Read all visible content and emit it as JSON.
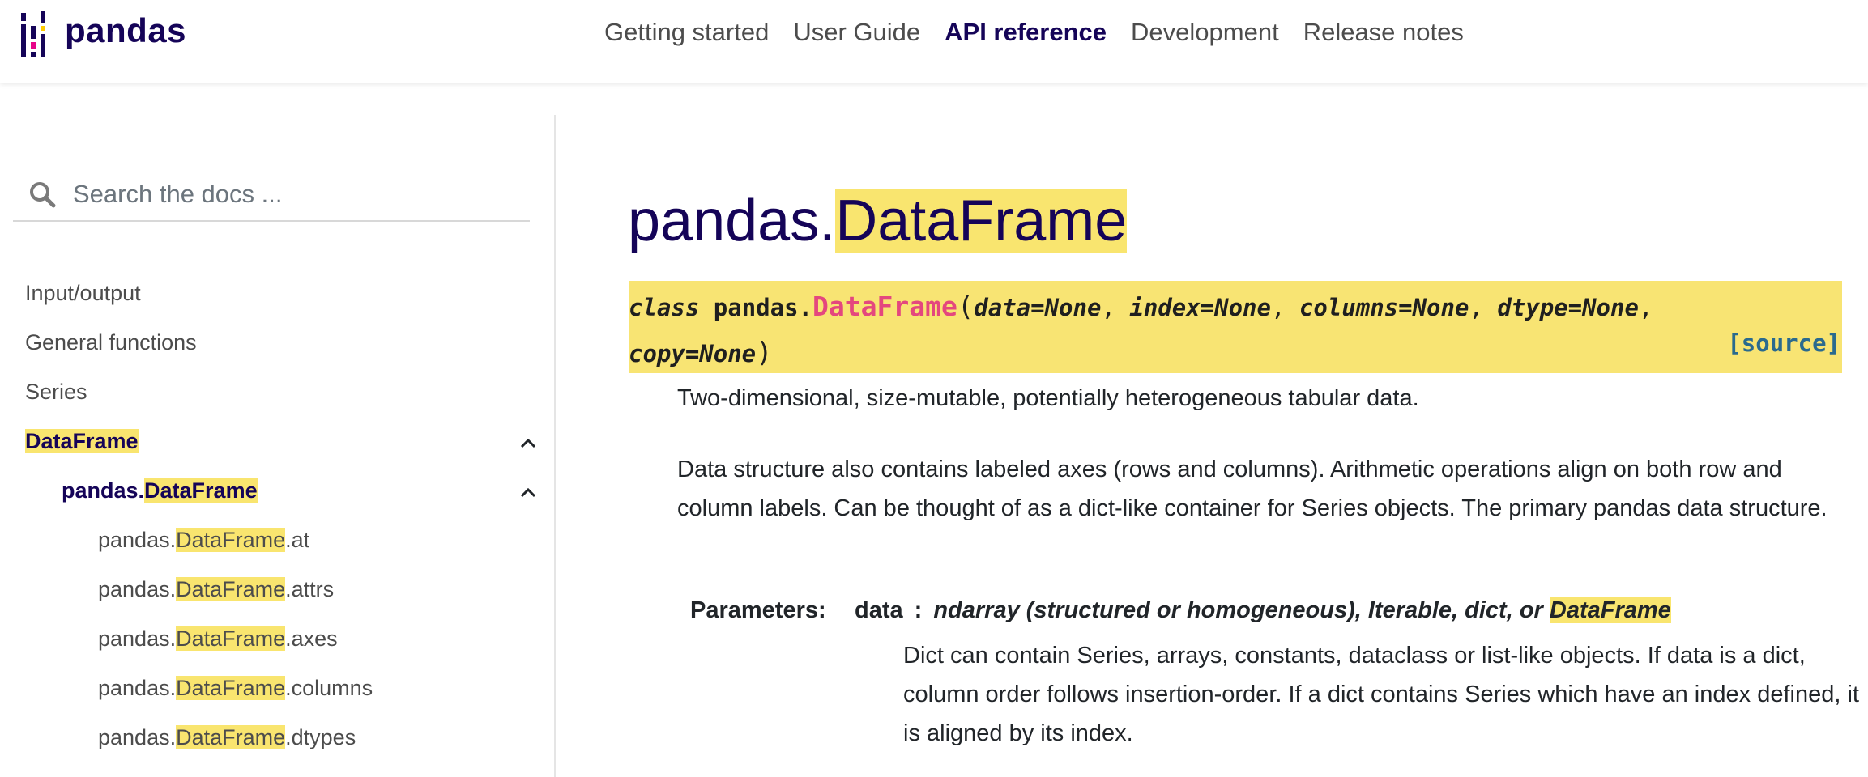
{
  "navbar": {
    "logo_text": "pandas",
    "links": [
      {
        "label": "Getting started",
        "active": false
      },
      {
        "label": "User Guide",
        "active": false
      },
      {
        "label": "API reference",
        "active": true
      },
      {
        "label": "Development",
        "active": false
      },
      {
        "label": "Release notes",
        "active": false
      }
    ]
  },
  "sidebar": {
    "search_placeholder": "Search the docs ...",
    "items": [
      {
        "label": "Input/output"
      },
      {
        "label": "General functions"
      },
      {
        "label": "Series"
      },
      {
        "label": "DataFrame"
      },
      {
        "prefix": "pandas.",
        "highlight": "DataFrame",
        "suffix": ""
      },
      {
        "prefix": "pandas.",
        "highlight": "DataFrame",
        "suffix": ".at"
      },
      {
        "prefix": "pandas.",
        "highlight": "DataFrame",
        "suffix": ".attrs"
      },
      {
        "prefix": "pandas.",
        "highlight": "DataFrame",
        "suffix": ".axes"
      },
      {
        "prefix": "pandas.",
        "highlight": "DataFrame",
        "suffix": ".columns"
      },
      {
        "prefix": "pandas.",
        "highlight": "DataFrame",
        "suffix": ".dtypes"
      }
    ]
  },
  "main": {
    "title_prefix": "pandas.",
    "title_highlight": "DataFrame",
    "signature": {
      "keyword": "class",
      "module": "pandas.",
      "name": "DataFrame",
      "open": "(",
      "close": ")",
      "params": [
        "data=None",
        "index=None",
        "columns=None",
        "dtype=None",
        "copy=None"
      ],
      "source_label": "[source]"
    },
    "summary": "Two-dimensional, size-mutable, potentially heterogeneous tabular data.",
    "description": "Data structure also contains labeled axes (rows and columns). Arithmetic operations align on both row and column labels. Can be thought of as a dict-like container for Series objects. The primary pandas data structure.",
    "parameters_label": "Parameters:",
    "params": [
      {
        "name": "data",
        "colon": ":",
        "type": "ndarray (structured or homogeneous), Iterable, dict, or ",
        "type_highlight": "DataFrame",
        "desc": "Dict can contain Series, arrays, constants, dataclass or list-like objects. If data is a dict, column order follows insertion-order. If a dict contains Series which have an index defined, it is aligned by its index."
      }
    ]
  },
  "colors": {
    "brand": "#150458",
    "highlight": "#f9e56f",
    "signature_bg": "#f8e473",
    "class_name": "#e4477e",
    "source_link": "#2a6a8e"
  }
}
